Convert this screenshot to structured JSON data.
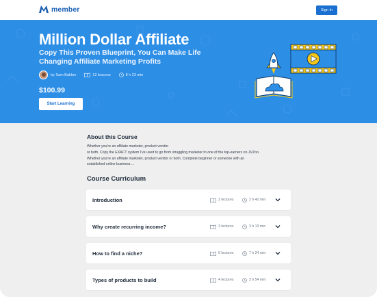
{
  "brand": {
    "name": "member",
    "color": "#1a5fb4"
  },
  "nav": {
    "signin_label": "Sign In"
  },
  "hero": {
    "title": "Million Dollar Affiliate",
    "subtitle": "Copy This Proven Blueprint, You Can Make Life Changing Affiliate Marketing Profits",
    "author": "by Sam Bakker",
    "lessons": "12 lessons",
    "duration": "8 h 23 min",
    "price": "$100.99",
    "cta_label": "Start Learning",
    "bg_color": "#2d8ee6"
  },
  "about": {
    "title": "About this Course",
    "lines": [
      "Whether you're an affiliate marketer, product vendor",
      "or both. Copy the EXACT system I've used to go from struggling marketer to one of the top-earners on JVZoo.",
      "Whether you're an affiliate marketer, product vendor or both. Complete beginner or someone with an",
      "established online business ..."
    ]
  },
  "curriculum": {
    "title": "Course Curriculum",
    "sections": [
      {
        "title": "Introduction",
        "lectures": "2 lectures",
        "duration": "2 h 42 min"
      },
      {
        "title": "Why create recurring income?",
        "lectures": "3 lectures",
        "duration": "3 h 13 min"
      },
      {
        "title": "How to find a niche?",
        "lectures": "6 lectures",
        "duration": "7 h 24 min"
      },
      {
        "title": "Types of products to build",
        "lectures": "4 lectures",
        "duration": "3 h 54 min"
      }
    ]
  },
  "icons": {
    "logo": "m-logo-icon",
    "lessons": "book-icon",
    "duration": "clock-icon",
    "expand": "chevron-down-icon"
  }
}
